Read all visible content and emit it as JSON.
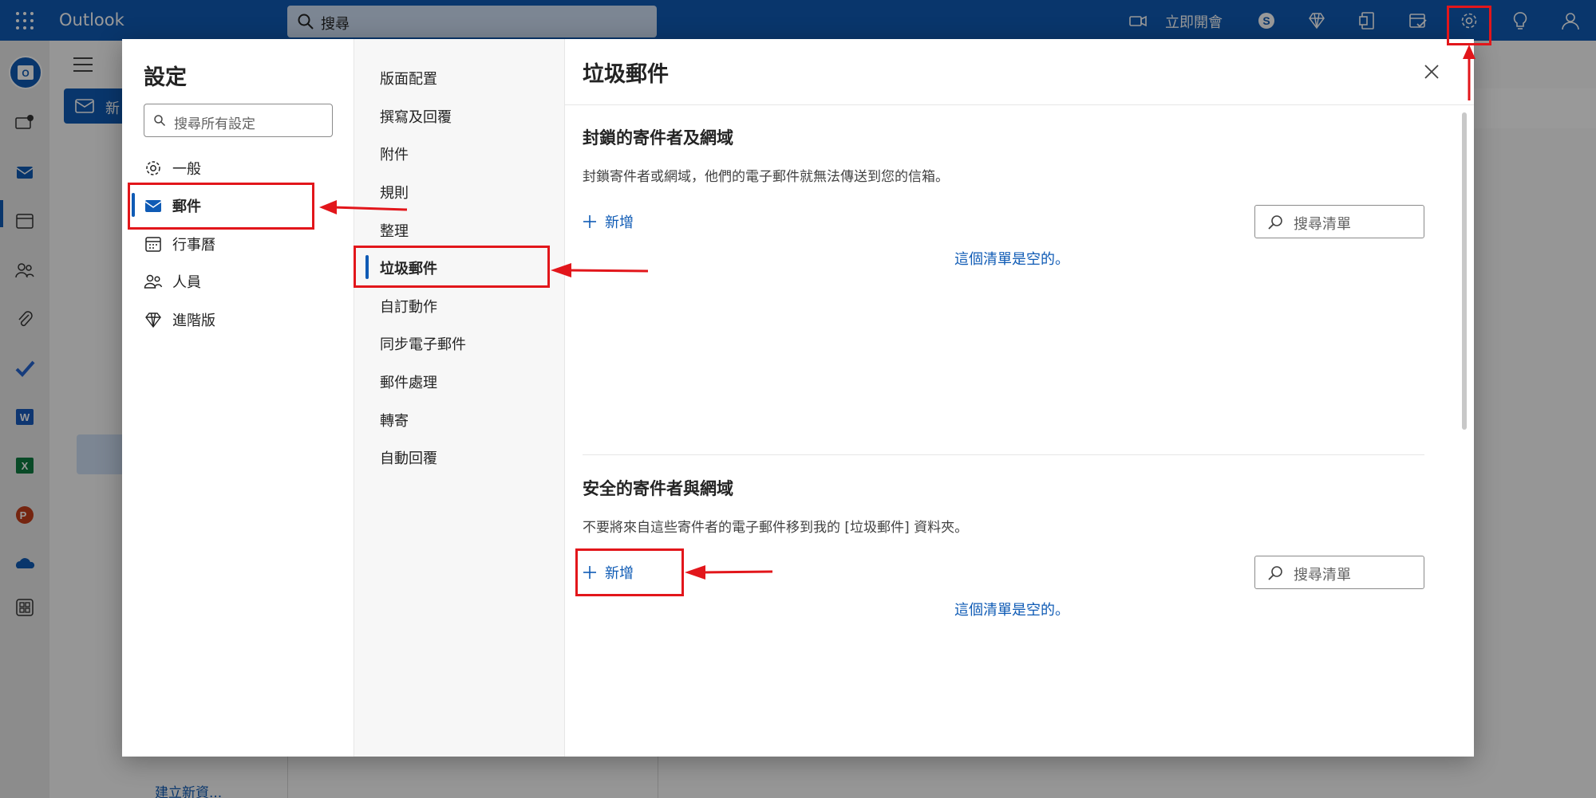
{
  "topbar": {
    "app_name": "Outlook",
    "search_placeholder": "搜尋",
    "meet_now_label": "立即開會",
    "icons": [
      "waffle-icon",
      "video-icon",
      "skype-icon",
      "premium-diamond-icon",
      "office-icon",
      "my-day-icon",
      "settings-gear-icon",
      "tips-bulb-icon",
      "account-icon"
    ]
  },
  "background": {
    "new_mail_label": "新",
    "create_new_label": "建立新資..."
  },
  "settings": {
    "title": "設定",
    "search_placeholder": "搜尋所有設定",
    "categories": [
      {
        "label": "一般",
        "icon": "gear-icon"
      },
      {
        "label": "郵件",
        "icon": "mail-icon",
        "active": true
      },
      {
        "label": "行事曆",
        "icon": "calendar-icon"
      },
      {
        "label": "人員",
        "icon": "people-icon"
      },
      {
        "label": "進階版",
        "icon": "diamond-icon"
      }
    ],
    "mail_subsections": [
      {
        "label": "版面配置"
      },
      {
        "label": "撰寫及回覆"
      },
      {
        "label": "附件"
      },
      {
        "label": "規則"
      },
      {
        "label": "整理"
      },
      {
        "label": "垃圾郵件",
        "active": true
      },
      {
        "label": "自訂動作"
      },
      {
        "label": "同步電子郵件"
      },
      {
        "label": "郵件處理"
      },
      {
        "label": "轉寄"
      },
      {
        "label": "自動回覆"
      }
    ]
  },
  "junk_pane": {
    "title": "垃圾郵件",
    "blocked": {
      "heading": "封鎖的寄件者及網域",
      "description": "封鎖寄件者或網域，他們的電子郵件就無法傳送到您的信箱。",
      "add_label": "新增",
      "search_placeholder": "搜尋清單",
      "empty_text": "這個清單是空的。"
    },
    "safe": {
      "heading": "安全的寄件者與網域",
      "description": "不要將來自這些寄件者的電子郵件移到我的 [垃圾郵件] 資料夾。",
      "add_label": "新增",
      "search_placeholder": "搜尋清單",
      "empty_text": "這個清單是空的。"
    }
  },
  "colors": {
    "brand": "#0f5bb5",
    "annotation": "#e2161b"
  }
}
